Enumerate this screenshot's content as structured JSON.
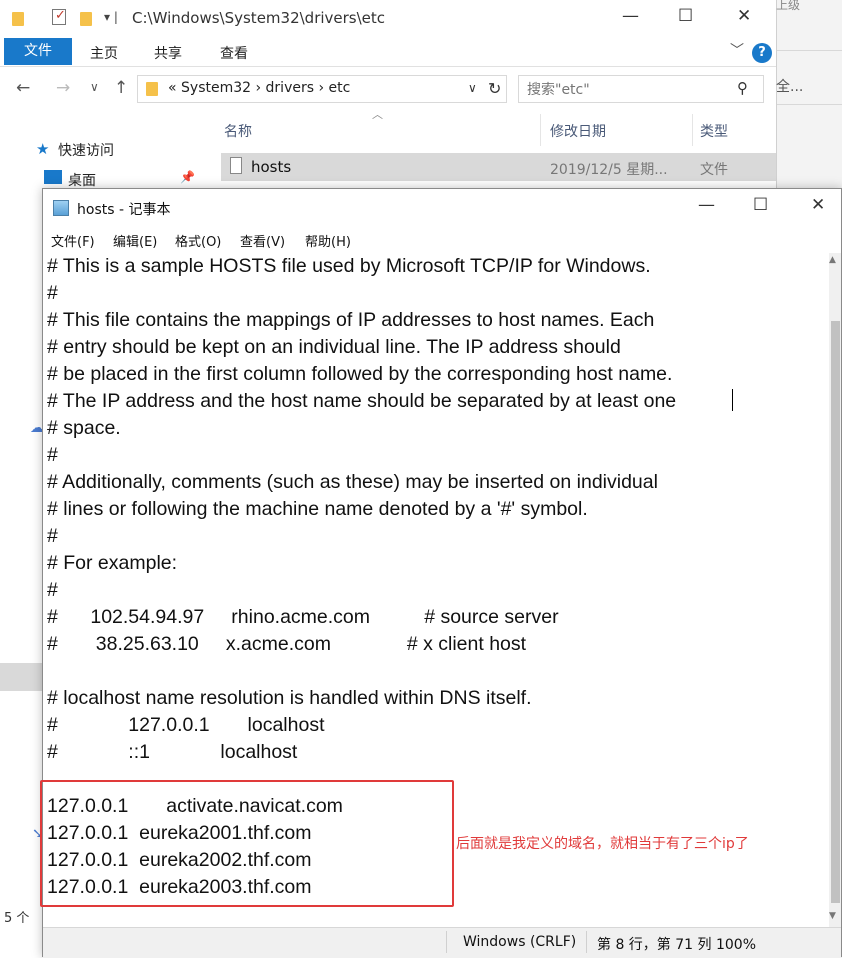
{
  "explorer": {
    "title": "C:\\Windows\\System32\\drivers\\etc",
    "controls": {
      "minimize": "—",
      "maximize": "☐",
      "close": "✕"
    },
    "ribbon_tabs": {
      "file": "文件",
      "home": "主页",
      "share": "共享",
      "view": "查看"
    },
    "help": "?",
    "address": "«  System32  ›  drivers  ›  etc",
    "search_placeholder": "搜索\"etc\"",
    "columns": {
      "name": "名称",
      "date": "修改日期",
      "type": "类型"
    },
    "file": {
      "name": "hosts",
      "date": "2019/12/5 星期...",
      "type": "文件"
    },
    "nav": {
      "quick_access": "快速访问",
      "desktop": "桌面"
    },
    "item_count": "5 个",
    "right_clip": {
      "top": "上级",
      "mid": "全..."
    }
  },
  "notepad": {
    "title": "hosts - 记事本",
    "controls": {
      "minimize": "—",
      "maximize": "☐",
      "close": "✕"
    },
    "menu": {
      "file": "文件(F)",
      "edit": "编辑(E)",
      "format": "格式(O)",
      "view": "查看(V)",
      "help": "帮助(H)"
    },
    "lines": [
      "# This is a sample HOSTS file used by Microsoft TCP/IP for Windows.",
      "#",
      "# This file contains the mappings of IP addresses to host names. Each",
      "# entry should be kept on an individual line. The IP address should",
      "# be placed in the first column followed by the corresponding host name.",
      "# The IP address and the host name should be separated by at least one",
      "# space.",
      "#",
      "# Additionally, comments (such as these) may be inserted on individual",
      "# lines or following the machine name denoted by a '#' symbol.",
      "#",
      "# For example:",
      "#",
      "#      102.54.94.97     rhino.acme.com          # source server",
      "#       38.25.63.10     x.acme.com              # x client host",
      "",
      "# localhost name resolution is handled within DNS itself.",
      "#             127.0.0.1       localhost",
      "#             ::1             localhost",
      "",
      "127.0.0.1       activate.navicat.com",
      "127.0.0.1  eureka2001.thf.com",
      "127.0.0.1  eureka2002.thf.com",
      "127.0.0.1  eureka2003.thf.com"
    ],
    "status": {
      "encoding": "Windows (CRLF)",
      "position": "第 8 行，第 71 列  100%"
    }
  },
  "annotation": {
    "text": "后面就是我定义的域名，就相当于有了三个ip了",
    "color": "#e03a3a"
  },
  "colors": {
    "accent": "#1979ca",
    "annotation": "#e03a3a",
    "selected_row": "#d9d9d9"
  }
}
